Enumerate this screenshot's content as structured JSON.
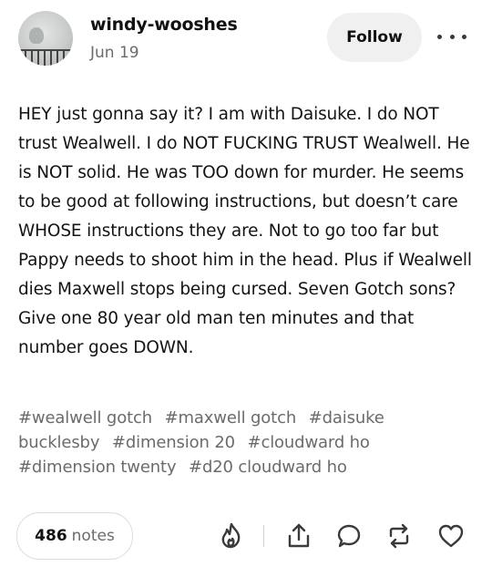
{
  "post": {
    "username": "windy-wooshes",
    "date": "Jun 19",
    "follow_label": "Follow",
    "body": "HEY just gonna say it? I am with Daisuke. I do NOT trust Wealwell. I do NOT FUCKING TRUST Wealwell. He is NOT solid. He was TOO down for murder. He seems to be good at following instructions, but doesn’t care WHOSE instructions they are. Not to go too far but Pappy needs to shoot him in the head. Plus if Wealwell dies Maxwell stops being cursed. Seven Gotch sons? Give one 80 year old man ten minutes and that number goes DOWN.",
    "tags": [
      "#wealwell gotch",
      "#maxwell gotch",
      "#daisuke bucklesby",
      "#dimension 20",
      "#cloudward ho",
      "#dimension twenty",
      "#d20 cloudward ho"
    ]
  },
  "footer": {
    "notes_count": "486",
    "notes_label": "notes",
    "actions": [
      "blaze-icon",
      "share-icon",
      "reply-icon",
      "reblog-icon",
      "like-icon"
    ]
  }
}
